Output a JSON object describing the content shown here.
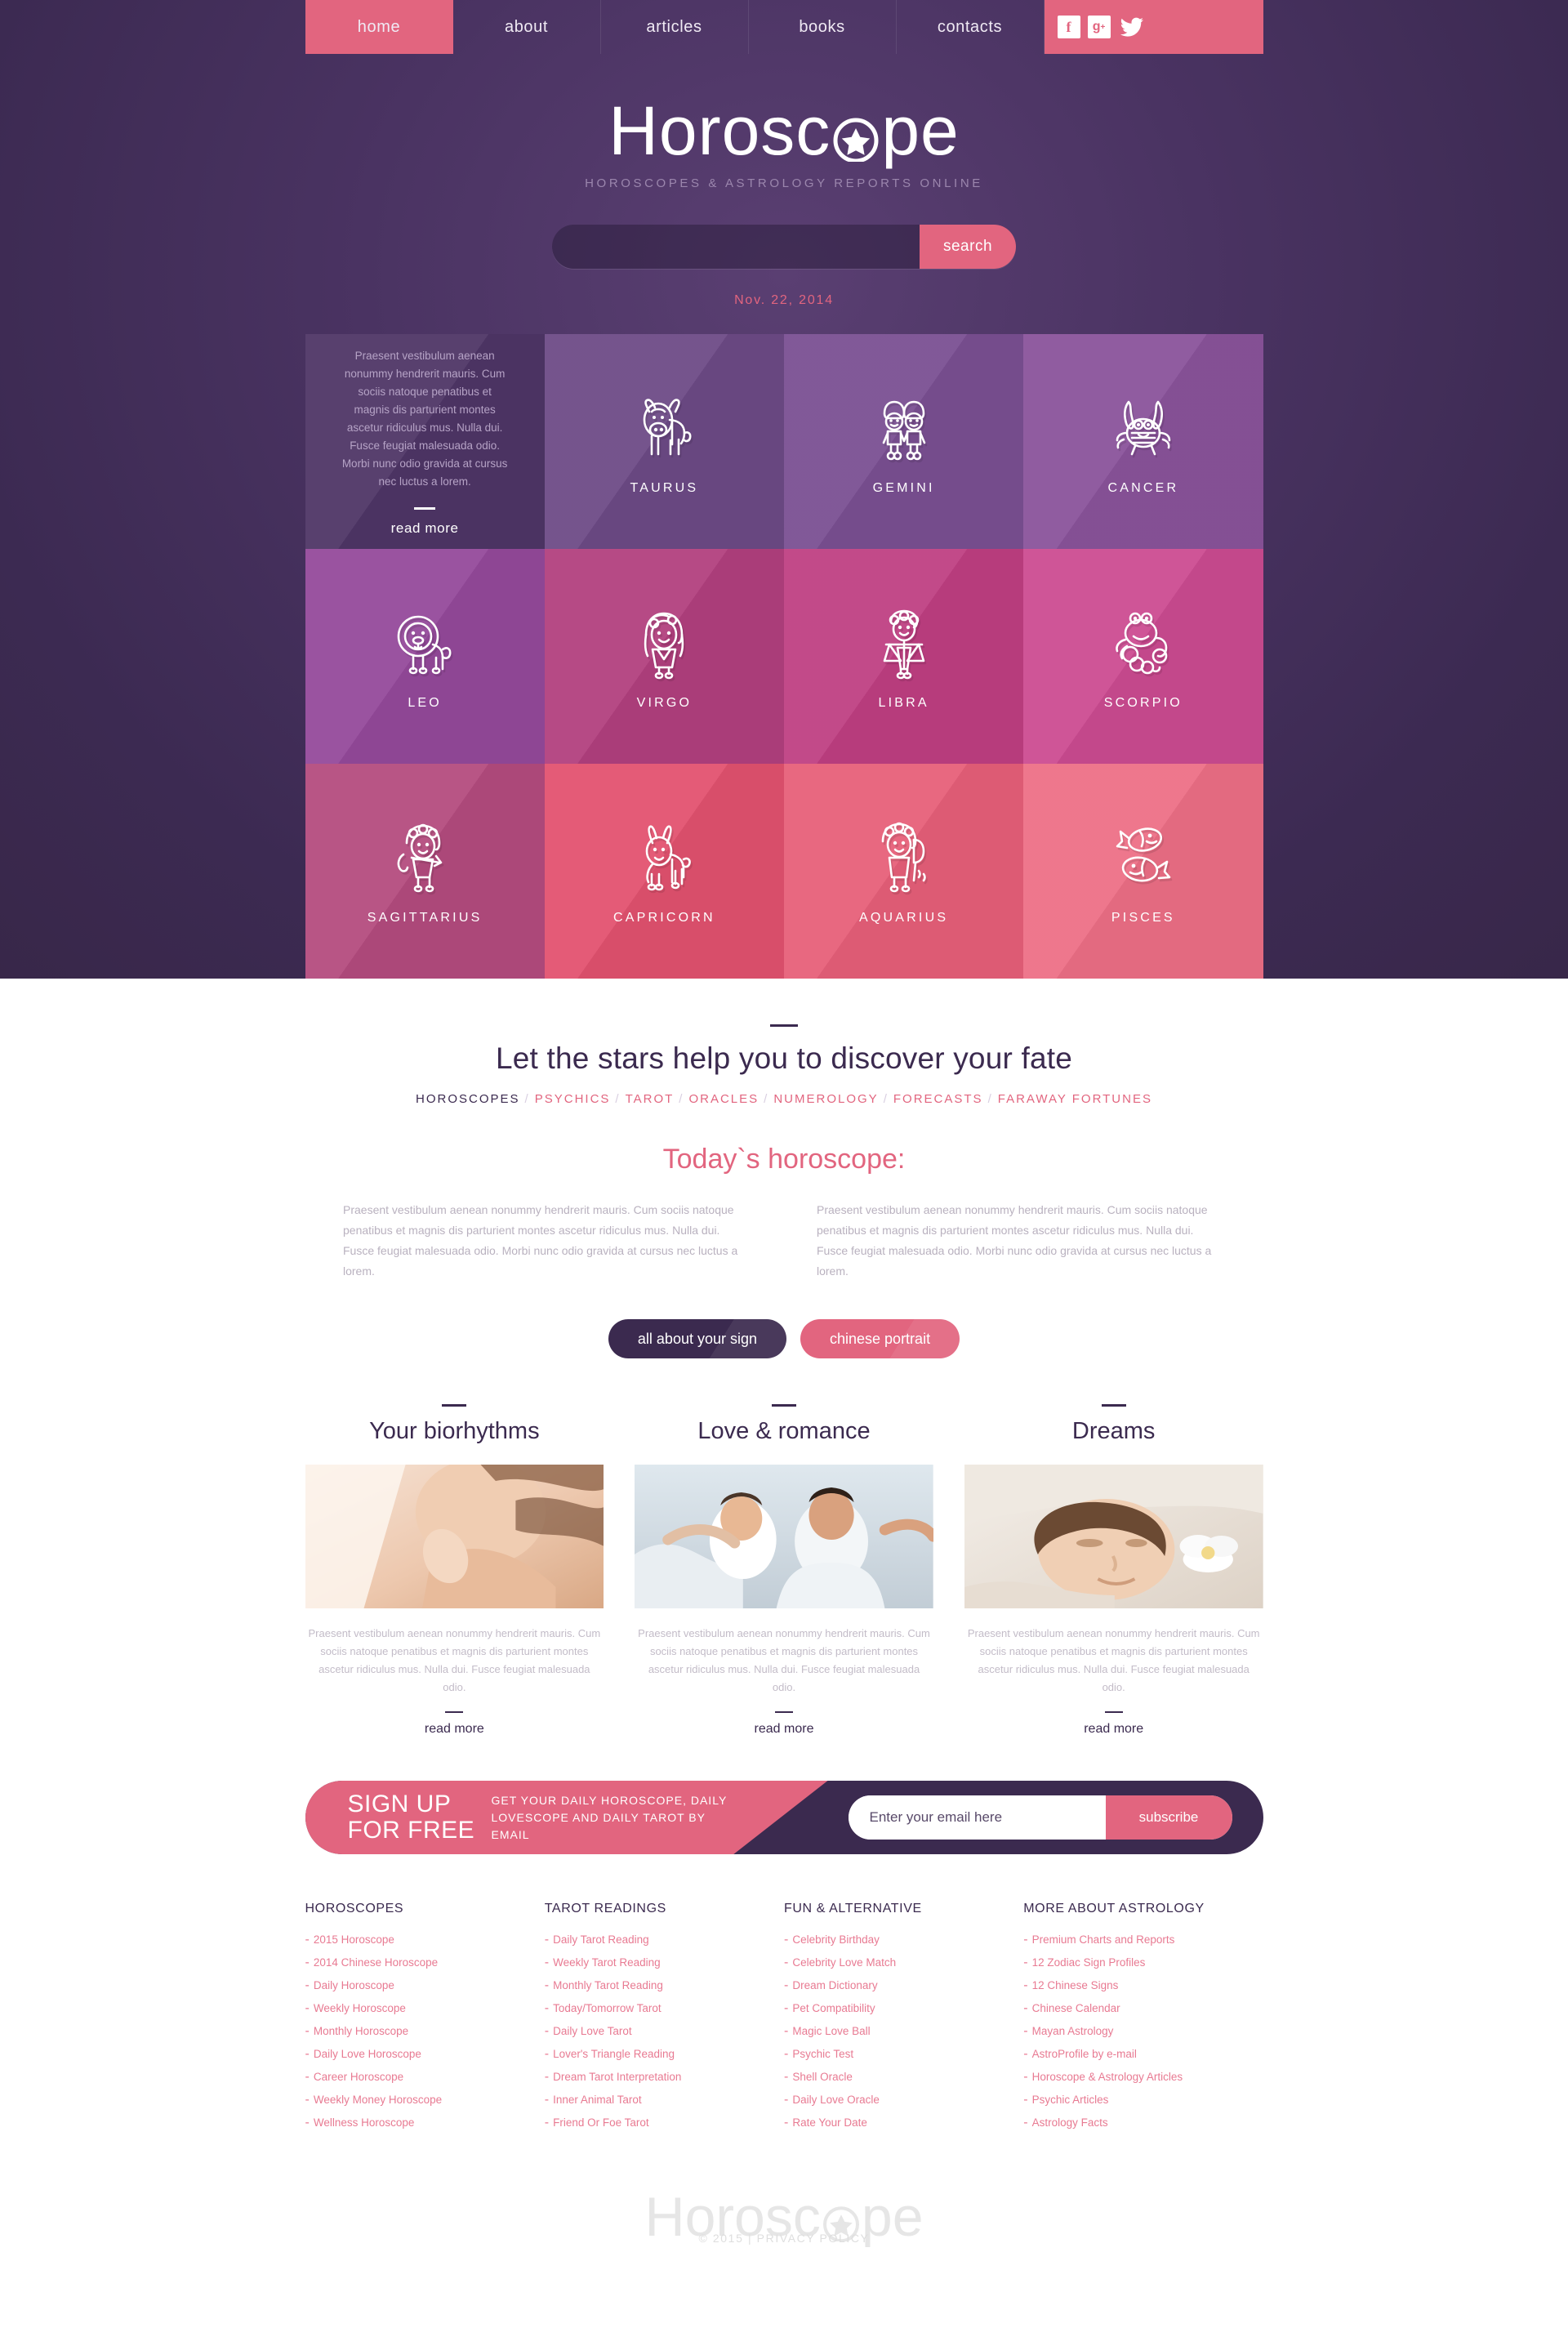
{
  "nav": {
    "items": [
      {
        "label": "home",
        "active": true
      },
      {
        "label": "about",
        "active": false
      },
      {
        "label": "articles",
        "active": false
      },
      {
        "label": "books",
        "active": false
      },
      {
        "label": "contacts",
        "active": false
      }
    ],
    "socials": [
      {
        "name": "facebook-icon",
        "glyph": "f"
      },
      {
        "name": "google-plus-icon",
        "glyph": "g+"
      },
      {
        "name": "twitter-icon",
        "glyph": "bird"
      }
    ]
  },
  "brand": {
    "name_before": "Horosc",
    "name_after": "pe",
    "full": "Horoscope",
    "tagline": "HOROSCOPES & ASTROLOGY REPORTS ONLINE"
  },
  "search": {
    "value": "",
    "placeholder": "",
    "button_label": "search"
  },
  "date": "Nov. 22, 2014",
  "intro_cell": {
    "text": "Praesent vestibulum aenean nonummy hendrerit mauris. Cum sociis natoque penatibus et magnis dis parturient montes ascetur ridiculus mus. Nulla dui. Fusce feugiat malesuada odio. Morbi nunc odio gravida at cursus nec luctus a lorem.",
    "read_more": "read more"
  },
  "zodiac": [
    {
      "name": "TAURUS",
      "icon": "taurus-icon",
      "color": "#6d4a86"
    },
    {
      "name": "GEMINI",
      "icon": "gemini-icon",
      "color": "#7a4f92"
    },
    {
      "name": "CANCER",
      "icon": "cancer-icon",
      "color": "#8a539b"
    },
    {
      "name": "LEO",
      "icon": "leo-icon",
      "color": "#94499b"
    },
    {
      "name": "VIRGO",
      "icon": "virgo-icon",
      "color": "#b2407e"
    },
    {
      "name": "LIBRA",
      "icon": "libra-icon",
      "color": "#bf3f82"
    },
    {
      "name": "SCORPIO",
      "icon": "scorpio-icon",
      "color": "#cc4b91"
    },
    {
      "name": "SAGITTARIUS",
      "icon": "sagittarius-icon",
      "color": "#b44b7e"
    },
    {
      "name": "CAPRICORN",
      "icon": "capricorn-icon",
      "color": "#e2526f"
    },
    {
      "name": "AQUARIUS",
      "icon": "aquarius-icon",
      "color": "#e75f79"
    },
    {
      "name": "PISCES",
      "icon": "pisces-icon",
      "color": "#ed6f86"
    }
  ],
  "zodiac_intro_color": "#4e3566",
  "fate": {
    "title": "Let the stars help you to discover your fate",
    "categories": [
      "HOROSCOPES",
      "PSYCHICS",
      "TAROT",
      "ORACLES",
      "NUMEROLOGY",
      "FORECASTS",
      "FARAWAY FORTUNES"
    ],
    "separator": "/"
  },
  "today": {
    "title": "Today`s horoscope:",
    "paragraphs": [
      "Praesent vestibulum aenean nonummy hendrerit mauris. Cum sociis natoque penatibus et magnis dis parturient montes ascetur ridiculus mus. Nulla dui. Fusce feugiat malesuada odio. Morbi nunc odio gravida at cursus nec luctus a lorem.",
      "Praesent vestibulum aenean nonummy hendrerit mauris. Cum sociis natoque penatibus et magnis dis parturient montes ascetur ridiculus mus. Nulla dui. Fusce feugiat malesuada odio. Morbi nunc odio gravida at cursus nec luctus a lorem."
    ],
    "buttons": [
      {
        "label": "all about your sign",
        "style": "dark"
      },
      {
        "label": "chinese portrait",
        "style": "pink"
      }
    ]
  },
  "features": [
    {
      "title": "Your biorhythms",
      "image": "woman-touching-neck-photo",
      "text": "Praesent vestibulum aenean nonummy hendrerit mauris. Cum sociis natoque penatibus et magnis dis parturient montes ascetur ridiculus mus. Nulla dui. Fusce feugiat malesuada odio.",
      "read_more": "read more"
    },
    {
      "title": "Love & romance",
      "image": "happy-couple-photo",
      "text": "Praesent vestibulum aenean nonummy hendrerit mauris. Cum sociis natoque penatibus et magnis dis parturient montes ascetur ridiculus mus. Nulla dui. Fusce feugiat malesuada odio.",
      "read_more": "read more"
    },
    {
      "title": "Dreams",
      "image": "sleeping-woman-photo",
      "text": "Praesent vestibulum aenean nonummy hendrerit mauris. Cum sociis natoque penatibus et magnis dis parturient montes ascetur ridiculus mus. Nulla dui. Fusce feugiat malesuada odio.",
      "read_more": "read more"
    }
  ],
  "signup": {
    "title": "SIGN UP FOR FREE",
    "subtitle": "GET YOUR DAILY HOROSCOPE, DAILY LOVESCOPE AND DAILY TAROT BY EMAIL",
    "email_value": "",
    "email_placeholder": "Enter your email here",
    "button_label": "subscribe"
  },
  "footer_columns": [
    {
      "heading": "HOROSCOPES",
      "links": [
        "2015 Horoscope",
        "2014 Chinese Horoscope",
        "Daily Horoscope",
        "Weekly Horoscope",
        "Monthly Horoscope",
        "Daily Love Horoscope",
        "Career Horoscope",
        "Weekly Money Horoscope",
        "Wellness Horoscope"
      ]
    },
    {
      "heading": "TAROT READINGS",
      "links": [
        "Daily Tarot Reading",
        "Weekly Tarot Reading",
        "Monthly Tarot Reading",
        "Today/Tomorrow Tarot",
        "Daily Love Tarot",
        "Lover's Triangle Reading",
        "Dream Tarot Interpretation",
        "Inner Animal Tarot",
        "Friend Or Foe Tarot"
      ]
    },
    {
      "heading": "FUN & ALTERNATIVE",
      "links": [
        "Celebrity Birthday",
        "Celebrity Love Match",
        "Dream Dictionary",
        "Pet Compatibility",
        "Magic Love Ball",
        "Psychic Test",
        "Shell Oracle",
        "Daily Love Oracle",
        "Rate Your Date"
      ]
    },
    {
      "heading": "MORE ABOUT ASTROLOGY",
      "links": [
        "Premium Charts and Reports",
        "12 Zodiac Sign Profiles",
        "12 Chinese Signs",
        "Chinese Calendar",
        "Mayan Astrology",
        "AstroProfile by e-mail",
        "Horoscope & Astrology Articles",
        "Psychic Articles",
        "Astrology Facts"
      ]
    }
  ],
  "footer": {
    "copyright": "© 2015 | PRIVACY POLICY"
  },
  "colors": {
    "accent_pink": "#e2657f",
    "dark_purple": "#3b2a4f",
    "hero_bg": "#3d2a53"
  }
}
